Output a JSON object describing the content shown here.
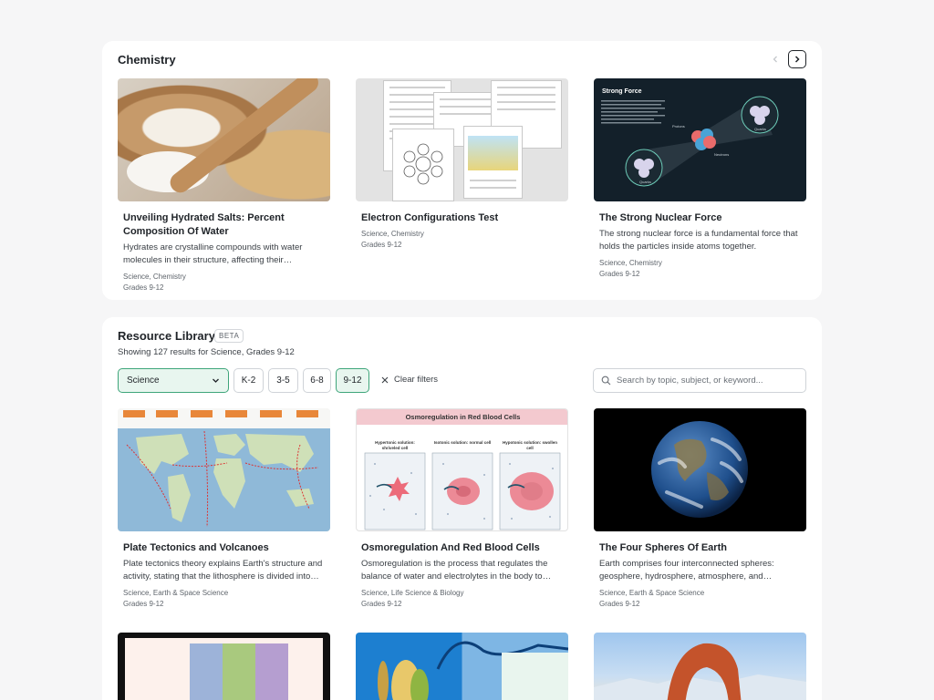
{
  "chemistry": {
    "title": "Chemistry",
    "cards": [
      {
        "title": "Unveiling Hydrated Salts: Percent Composition Of Water",
        "description": "Hydrates are crystalline compounds with water molecules in their structure, affecting their…",
        "subject": "Science, Chemistry",
        "grades": "Grades 9-12"
      },
      {
        "title": "Electron Configurations Test",
        "description": "",
        "subject": "Science, Chemistry",
        "grades": "Grades 9-12"
      },
      {
        "title": "The Strong Nuclear Force",
        "description": "The strong nuclear force is a fundamental force that holds the particles inside atoms together.",
        "subject": "Science, Chemistry",
        "grades": "Grades 9-12",
        "thumb_title": "Strong Force",
        "thumb_labels": [
          "Protons",
          "Neutrons",
          "Quarks",
          "Quarks"
        ]
      }
    ]
  },
  "library": {
    "title": "Resource Library",
    "badge": "BETA",
    "subtitle": "Showing 127 results for Science, Grades 9-12",
    "subject_select": "Science",
    "grade_chips": [
      {
        "label": "K-2",
        "active": false
      },
      {
        "label": "3-5",
        "active": false
      },
      {
        "label": "6-8",
        "active": false
      },
      {
        "label": "9-12",
        "active": true
      }
    ],
    "clear_label": "Clear filters",
    "search_placeholder": "Search by topic, subject, or keyword...",
    "cards": [
      {
        "title": "Plate Tectonics and Volcanoes",
        "description": "Plate tectonics theory explains Earth's structure and activity, stating that the lithosphere is divided into…",
        "subject": "Science, Earth & Space Science",
        "grades": "Grades 9-12"
      },
      {
        "title": "Osmoregulation And Red Blood Cells",
        "description": "Osmoregulation is the process that regulates the balance of water and electrolytes in the body to…",
        "subject": "Science, Life Science & Biology",
        "grades": "Grades 9-12",
        "thumb_title": "Osmoregulation in Red Blood Cells",
        "thumb_columns": [
          "Hypertonic solution: shriveled cell",
          "Isotonic solution: normal cell",
          "Hypotonic solution: swollen cell"
        ]
      },
      {
        "title": "The Four Spheres Of Earth",
        "description": "Earth comprises four interconnected spheres: geosphere, hydrosphere, atmosphere, and…",
        "subject": "Science, Earth & Space Science",
        "grades": "Grades 9-12"
      }
    ]
  },
  "colors": {
    "accent_green": "#3ea57a",
    "accent_bg": "#e8f6ef",
    "page_bg": "#f6f6f7"
  },
  "icons": {
    "prev": "chevron-left-icon",
    "next": "chevron-right-icon",
    "dropdown": "chevron-down-icon",
    "clear": "close-icon",
    "search": "search-icon"
  }
}
